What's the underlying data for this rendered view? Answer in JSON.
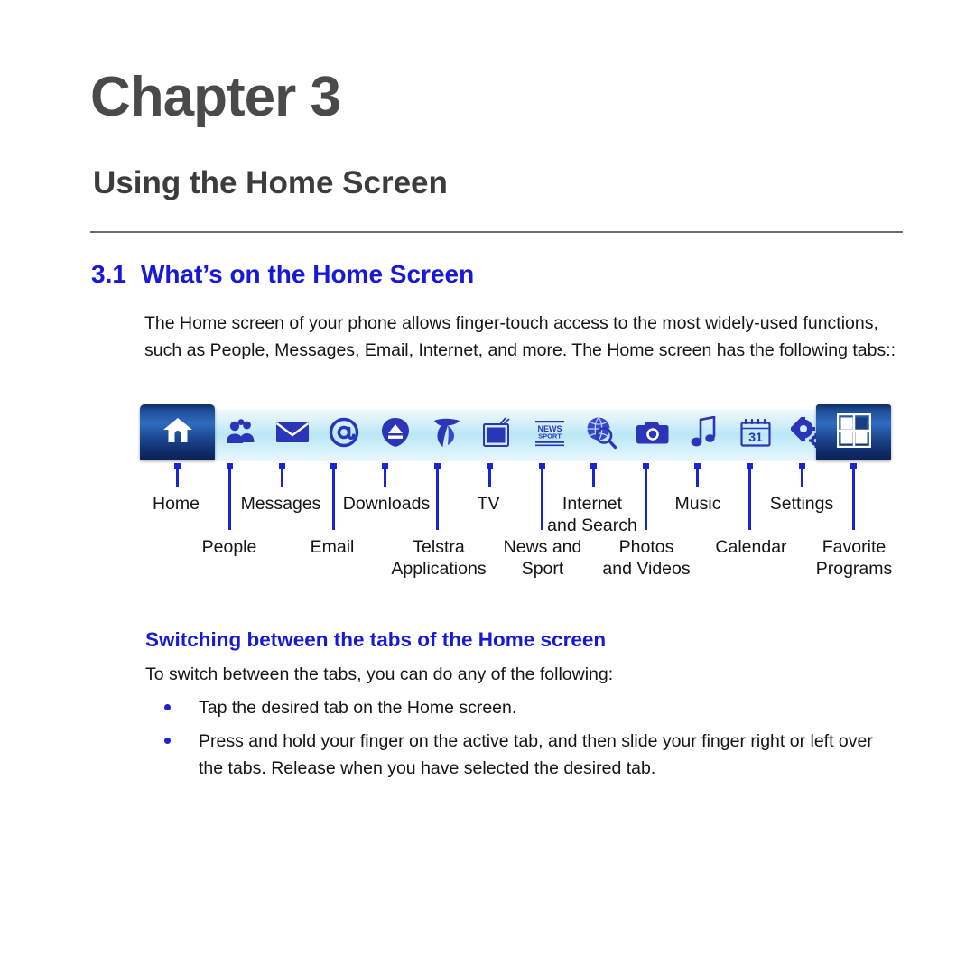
{
  "page": {
    "background_color": "#ffffff",
    "accent_blue": "#1818d8",
    "title_gray": "#4a4a4a"
  },
  "chapter": {
    "number": "Chapter 3",
    "title": "Using the Home Screen"
  },
  "section": {
    "number": "3.1",
    "heading": "What’s on the Home Screen",
    "intro": "The Home screen of your phone allows finger-touch access to the most widely-used functions, such as People, Messages, Email, Internet, and more. The Home screen has the following tabs::"
  },
  "tabbar": {
    "tabs": [
      {
        "id": "home",
        "label": "Home",
        "icon": "home-icon",
        "selected": true
      },
      {
        "id": "people",
        "label": "People",
        "icon": "people-icon",
        "selected": false
      },
      {
        "id": "messages",
        "label": "Messages",
        "icon": "envelope-icon",
        "selected": false
      },
      {
        "id": "email",
        "label": "Email",
        "icon": "at-sign-icon",
        "selected": false
      },
      {
        "id": "downloads",
        "label": "Downloads",
        "icon": "download-shield-icon",
        "selected": false
      },
      {
        "id": "telstra",
        "label": "Telstra\nApplications",
        "icon": "telstra-t-icon",
        "selected": false
      },
      {
        "id": "tv",
        "label": "TV",
        "icon": "television-icon",
        "selected": false
      },
      {
        "id": "news-sport",
        "label": "News and\nSport",
        "icon": "newspaper-icon",
        "selected": false
      },
      {
        "id": "internet-search",
        "label": "Internet\nand Search",
        "icon": "globe-search-icon",
        "selected": false
      },
      {
        "id": "photos-videos",
        "label": "Photos\nand Videos",
        "icon": "camera-icon",
        "selected": false
      },
      {
        "id": "music",
        "label": "Music",
        "icon": "music-note-icon",
        "selected": false
      },
      {
        "id": "calendar",
        "label": "Calendar",
        "icon": "calendar-icon",
        "selected": false
      },
      {
        "id": "settings",
        "label": "Settings",
        "icon": "gears-icon",
        "selected": false
      },
      {
        "id": "favorite-programs",
        "label": "Favorite\nPrograms",
        "icon": "grid-squares-icon",
        "selected": true
      }
    ],
    "calendar_day": "31",
    "news_icon_text": "NEWS\nSPORT"
  },
  "subsection": {
    "heading": "Switching between the tabs of the Home screen",
    "intro": "To switch between the tabs, you can do any of the following:",
    "bullets": [
      "Tap the desired tab on the Home screen.",
      "Press and hold your finger on the active tab, and then slide your finger right or left over the tabs. Release when you have selected the desired tab."
    ]
  }
}
